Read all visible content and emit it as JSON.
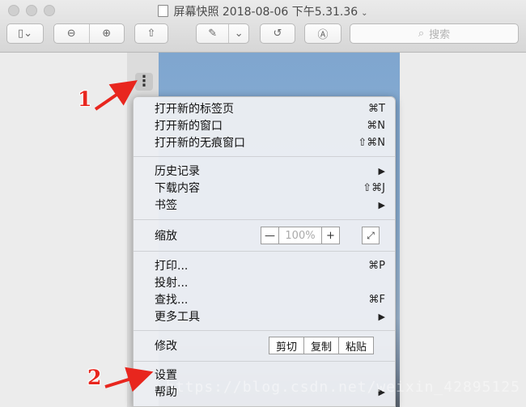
{
  "window": {
    "title": "屏幕快照 2018-08-06 下午5.31.36",
    "title_chevron": "⌄"
  },
  "toolbar": {
    "search_placeholder": "搜索",
    "sidebar_toggle": "▯⌄",
    "zoom_out": "⊖",
    "zoom_in": "⊕",
    "share": "⇧",
    "markup": "✎",
    "markup_chevron": "⌄",
    "rotate": "↺",
    "annotate": "Ⓐ"
  },
  "kebab_glyph": "⋮",
  "menu": {
    "group1": [
      {
        "label": "打开新的标签页",
        "shortcut": "⌘T"
      },
      {
        "label": "打开新的窗口",
        "shortcut": "⌘N"
      },
      {
        "label": "打开新的无痕窗口",
        "shortcut": "⇧⌘N"
      }
    ],
    "group2": [
      {
        "label": "历史记录",
        "shortcut": "▶"
      },
      {
        "label": "下载内容",
        "shortcut": "⇧⌘J"
      },
      {
        "label": "书签",
        "shortcut": "▶"
      }
    ],
    "zoom": {
      "label": "缩放",
      "minus": "—",
      "value": "100%",
      "plus": "+",
      "fullscreen": "⤢"
    },
    "group3": [
      {
        "label": "打印...",
        "shortcut": "⌘P"
      },
      {
        "label": "投射...",
        "shortcut": ""
      },
      {
        "label": "查找...",
        "shortcut": "⌘F"
      },
      {
        "label": "更多工具",
        "shortcut": "▶"
      }
    ],
    "edit": {
      "label": "修改",
      "cut": "剪切",
      "copy": "复制",
      "paste": "粘贴"
    },
    "group4": [
      {
        "label": "设置",
        "shortcut": ""
      },
      {
        "label": "帮助",
        "shortcut": "▶"
      }
    ]
  },
  "annotations": {
    "step1": "1",
    "step2": "2"
  },
  "watermark": "https://blog.csdn.net/weixin_42895125",
  "colors": {
    "annotation_red": "#e8261e"
  }
}
